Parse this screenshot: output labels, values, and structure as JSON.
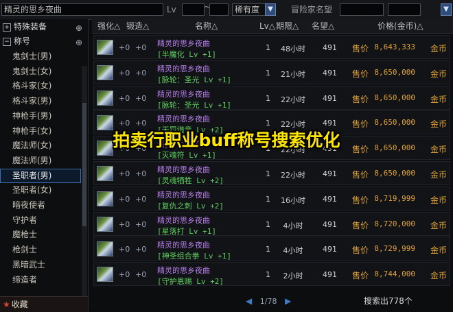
{
  "search": {
    "value": "精灵的思乡夜曲",
    "level_label": "Lv",
    "range_sep": "~",
    "rarity": "稀有度",
    "reputation_label": "冒险家名望",
    "rep_sep": "~"
  },
  "sidebar": {
    "cat_equip": "特殊装备",
    "cat_title": "称号",
    "items": [
      "鬼剑士(男)",
      "鬼剑士(女)",
      "格斗家(女)",
      "格斗家(男)",
      "神枪手(男)",
      "神枪手(女)",
      "魔法师(女)",
      "魔法师(男)",
      "圣职者(男)",
      "圣职者(女)",
      "暗夜使者",
      "守护者",
      "魔枪士",
      "枪剑士",
      "黑暗武士",
      "缔造者"
    ],
    "favorites": "收藏"
  },
  "table": {
    "headers": [
      "强化△",
      "锻造△",
      "名称△",
      "Lv△",
      "期限△",
      "名望△",
      "价格(金币)△"
    ],
    "rows": [
      {
        "enh": "+0",
        "forge": "+0",
        "name": "精灵的思乡夜曲",
        "tag": "[半魔化 Lv +1]",
        "lv": "1",
        "time": "48小时",
        "rep": "491",
        "sell": "售价",
        "price": "8,643,333",
        "unit": "金币"
      },
      {
        "enh": "+0",
        "forge": "+0",
        "name": "精灵的思乡夜曲",
        "tag": "[脉轮：圣光 Lv +1]",
        "lv": "1",
        "time": "21小时",
        "rep": "491",
        "sell": "售价",
        "price": "8,650,000",
        "unit": "金币"
      },
      {
        "enh": "+0",
        "forge": "+0",
        "name": "精灵的思乡夜曲",
        "tag": "[脉轮：圣光 Lv +1]",
        "lv": "1",
        "time": "22小时",
        "rep": "491",
        "sell": "售价",
        "price": "8,650,000",
        "unit": "金币"
      },
      {
        "enh": "+0",
        "forge": "+0",
        "name": "精灵的思乡夜曲",
        "tag": "[天罚谐音 Lv +2]",
        "lv": "1",
        "time": "22小时",
        "rep": "491",
        "sell": "售价",
        "price": "8,650,000",
        "unit": "金币"
      },
      {
        "enh": "+0",
        "forge": "+0",
        "name": "精灵的思乡夜曲",
        "tag": "[灭魂符 Lv +1]",
        "lv": "1",
        "time": "22小时",
        "rep": "491",
        "sell": "售价",
        "price": "8,650,000",
        "unit": "金币"
      },
      {
        "enh": "+0",
        "forge": "+0",
        "name": "精灵的思乡夜曲",
        "tag": "[灵魂牺牲 Lv +2]",
        "lv": "1",
        "time": "22小时",
        "rep": "491",
        "sell": "售价",
        "price": "8,650,000",
        "unit": "金币"
      },
      {
        "enh": "+0",
        "forge": "+0",
        "name": "精灵的思乡夜曲",
        "tag": "[复仇之刺 Lv +2]",
        "lv": "1",
        "time": "16小时",
        "rep": "491",
        "sell": "售价",
        "price": "8,719,999",
        "unit": "金币"
      },
      {
        "enh": "+0",
        "forge": "+0",
        "name": "精灵的思乡夜曲",
        "tag": "[星落打 Lv +1]",
        "lv": "1",
        "time": "4小时",
        "rep": "491",
        "sell": "售价",
        "price": "8,720,000",
        "unit": "金币"
      },
      {
        "enh": "+0",
        "forge": "+0",
        "name": "精灵的思乡夜曲",
        "tag": "[神圣组合拳 Lv +1]",
        "lv": "1",
        "time": "4小时",
        "rep": "491",
        "sell": "售价",
        "price": "8,729,999",
        "unit": "金币"
      },
      {
        "enh": "+0",
        "forge": "+0",
        "name": "精灵的思乡夜曲",
        "tag": "[守护恩赐 Lv +2]",
        "lv": "1",
        "time": "2小时",
        "rep": "491",
        "sell": "售价",
        "price": "8,744,000",
        "unit": "金币"
      }
    ]
  },
  "overlay": "拍卖行职业buff称号搜索优化",
  "pager": {
    "page": "1/78"
  },
  "footer": {
    "found": "搜索出778个"
  },
  "colors": {
    "accent": "#3e6fb0",
    "price": "#e0a33a",
    "skill_tag": "#5fd05f",
    "item_name": "#b57de8",
    "overlay": "#ffe600"
  }
}
